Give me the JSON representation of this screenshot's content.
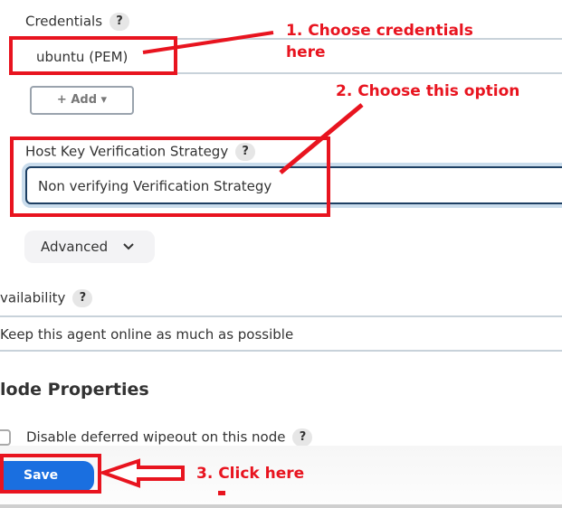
{
  "credentials": {
    "label": "Credentials",
    "help": "?",
    "value": "ubuntu (PEM)",
    "add_button": "+ Add",
    "add_caret": "▾"
  },
  "host_key": {
    "label": "Host Key Verification Strategy",
    "help": "?",
    "value": "Non verifying Verification Strategy"
  },
  "advanced": {
    "label": "Advanced",
    "chevron": "⌄"
  },
  "availability": {
    "label": "vailability",
    "help": "?",
    "value": "Keep this agent online as much as possible"
  },
  "node_properties": {
    "title": "lode Properties",
    "checkbox_label": "Disable deferred wipeout on this node",
    "checkbox_checked": false,
    "help": "?"
  },
  "footer": {
    "save_label": "Save"
  },
  "annotations": {
    "step1_line1": "1. Choose credentials",
    "step1_line2": "here",
    "step2": "2. Choose this option",
    "step3": "3. Click here",
    "color": "#e8141f"
  },
  "colors": {
    "primary": "#1a6fe0",
    "focus_border": "#1d3f63",
    "annotation_red": "#e8141f"
  }
}
